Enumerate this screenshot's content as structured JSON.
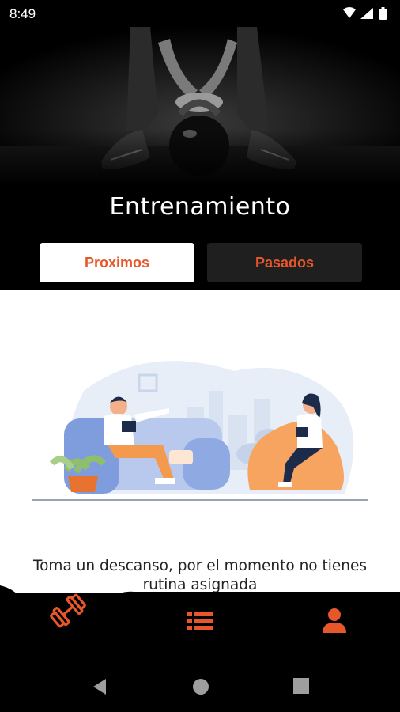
{
  "status_bar": {
    "time": "8:49",
    "icons": [
      "wifi-icon",
      "signal-icon",
      "battery-icon"
    ]
  },
  "header": {
    "title": "Entrenamiento"
  },
  "tabs": [
    {
      "label": "Proximos",
      "active": true
    },
    {
      "label": "Pasados",
      "active": false
    }
  ],
  "empty_state": {
    "message": "Toma un descanso, por el momento no tienes rutina asignada"
  },
  "bottom_nav": {
    "items": [
      {
        "icon": "dumbbell-icon",
        "active": true
      },
      {
        "icon": "list-icon",
        "active": false
      },
      {
        "icon": "profile-icon",
        "active": false
      }
    ]
  },
  "system_nav": {
    "buttons": [
      "back-icon",
      "home-icon",
      "recents-icon"
    ]
  },
  "colors": {
    "accent": "#e8572a",
    "header_bg": "#000000",
    "tab_inactive_bg": "#1f1f1f",
    "content_bg": "#ffffff"
  }
}
